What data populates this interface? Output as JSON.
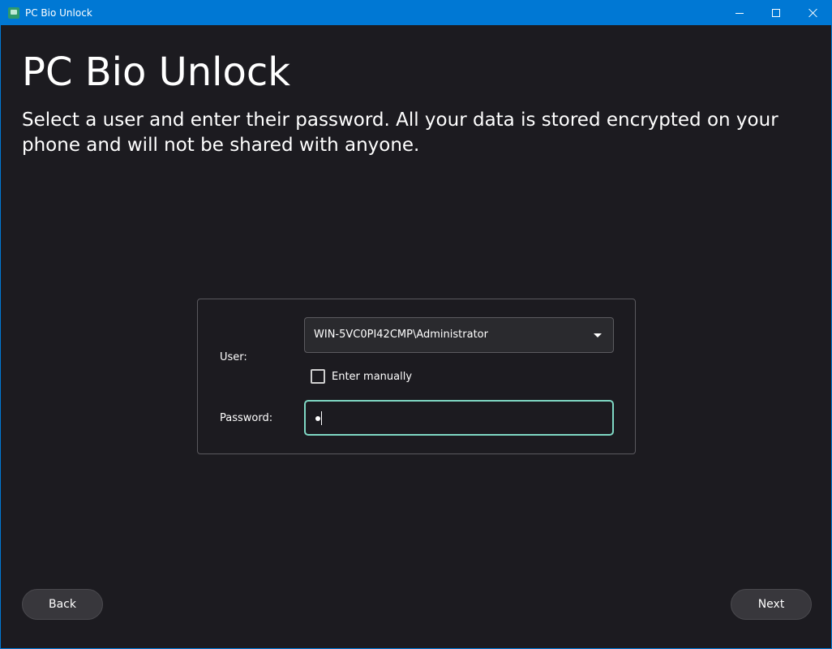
{
  "window": {
    "title": "PC Bio Unlock",
    "accent_color": "#0078d4",
    "background_color": "#1c1b20"
  },
  "main": {
    "heading": "PC Bio Unlock",
    "subtitle": "Select a user and enter their password. All your data is stored encrypted on your phone and will not be shared with anyone."
  },
  "form": {
    "user_label": "User:",
    "user_selected": "WIN-5VC0PI42CMP\\Administrator",
    "enter_manually_label": "Enter manually",
    "enter_manually_checked": false,
    "password_label": "Password:",
    "password_mask": "•",
    "focus_color": "#7fd8c4"
  },
  "footer": {
    "back_label": "Back",
    "next_label": "Next"
  },
  "icons": [
    "app-icon",
    "minimize-icon",
    "maximize-icon",
    "close-icon",
    "chevron-down-icon",
    "checkbox-icon"
  ]
}
